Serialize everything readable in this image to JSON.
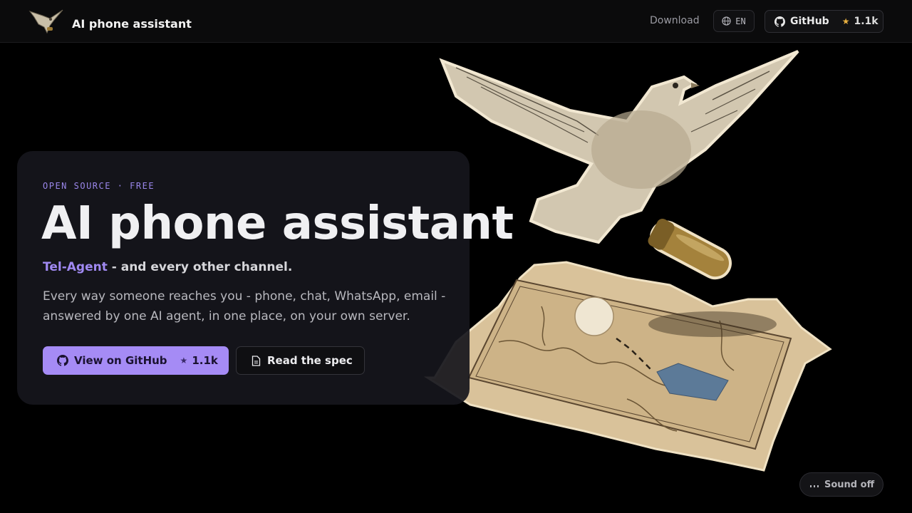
{
  "header": {
    "brand": "AI phone assistant",
    "nav_download": "Download",
    "lang": "EN",
    "github_label": "GitHub",
    "github_star_icon": "star-icon",
    "github_count": "1.1k"
  },
  "hero": {
    "eyebrow": "OPEN SOURCE · FREE",
    "title": "AI phone assistant",
    "tagline_accent": "Tel-Agent",
    "tagline_rest": " - and every other channel.",
    "description": "Every way someone reaches you - phone, chat, WhatsApp, email - answered by one AI agent, in one place, on your own server.",
    "primary_button": "View on GitHub",
    "primary_count": "1.1k",
    "secondary_button": "Read the spec"
  },
  "sound": {
    "label": "Sound off",
    "icon": "sound-waves-icon"
  },
  "colors": {
    "accent": "#a58bf5",
    "background": "#000000",
    "star": "#e8b040"
  }
}
